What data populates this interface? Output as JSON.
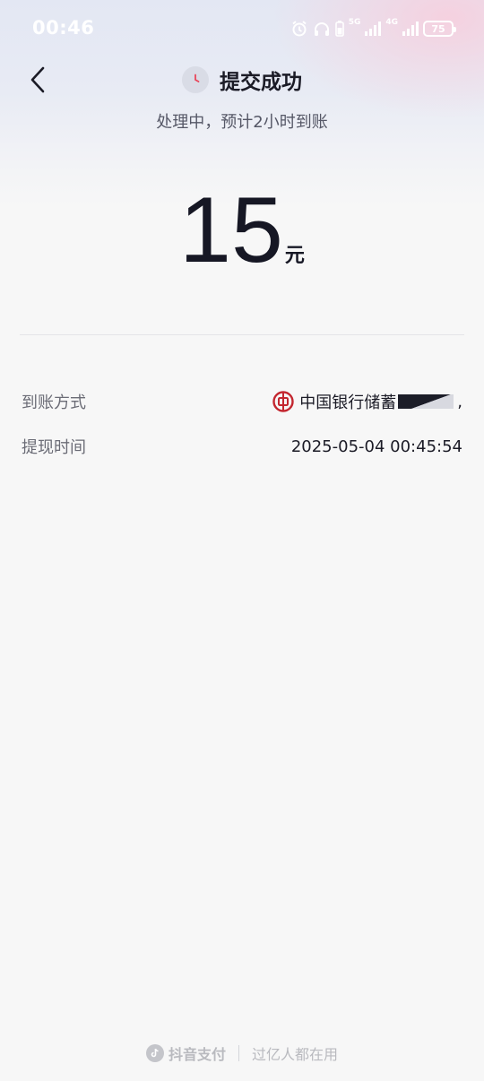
{
  "status_bar": {
    "time": "00:46",
    "network_5g": "5G",
    "network_4g": "4G",
    "battery": "75"
  },
  "header": {
    "title": "提交成功",
    "subtitle": "处理中，预计2小时到账"
  },
  "amount": {
    "value": "15",
    "unit": "元"
  },
  "details": [
    {
      "label": "到账方式",
      "value": "中国银行储蓄",
      "value_tail": ","
    },
    {
      "label": "提现时间",
      "value": "2025-05-04 00:45:54"
    }
  ],
  "footer": {
    "brand": "抖音支付",
    "slogan": "过亿人都在用"
  },
  "colors": {
    "bank_red": "#c3262f",
    "clock_accent": "#e8465a",
    "text_primary": "#1b1b26",
    "text_secondary": "#6b6c76"
  }
}
